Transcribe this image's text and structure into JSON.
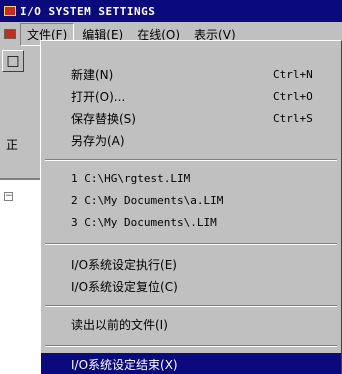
{
  "window": {
    "title": "I/O SYSTEM SETTINGS"
  },
  "menubar": {
    "items": [
      {
        "label": "文件(F)"
      },
      {
        "label": "编辑(E)"
      },
      {
        "label": "在线(O)"
      },
      {
        "label": "表示(V)"
      }
    ]
  },
  "background": {
    "toolbar_button": "□",
    "side_label": "正",
    "tree_toggle": "−"
  },
  "file_menu": {
    "new": {
      "label": "新建(N)",
      "shortcut": "Ctrl+N"
    },
    "open": {
      "label": "打开(O)...",
      "shortcut": "Ctrl+O"
    },
    "save_replace": {
      "label": "保存替换(S)",
      "shortcut": "Ctrl+S"
    },
    "save_as": {
      "label": "另存为(A)"
    },
    "recent_files": [
      {
        "label": "1 C:\\HG\\rgtest.LIM"
      },
      {
        "label": "2 C:\\My Documents\\a.LIM"
      },
      {
        "label": "3 C:\\My Documents\\.LIM"
      }
    ],
    "io_execute": {
      "label": "I/O系统设定执行(E)"
    },
    "io_reset": {
      "label": "I/O系统设定复位(C)"
    },
    "read_previous": {
      "label": "读出以前的文件(I)"
    },
    "io_exit": {
      "label": "I/O系统设定结束(X)"
    }
  },
  "colors": {
    "titlebar": "#0a0a7c",
    "highlight": "#0a0a7c",
    "face": "#c0c0c0"
  }
}
